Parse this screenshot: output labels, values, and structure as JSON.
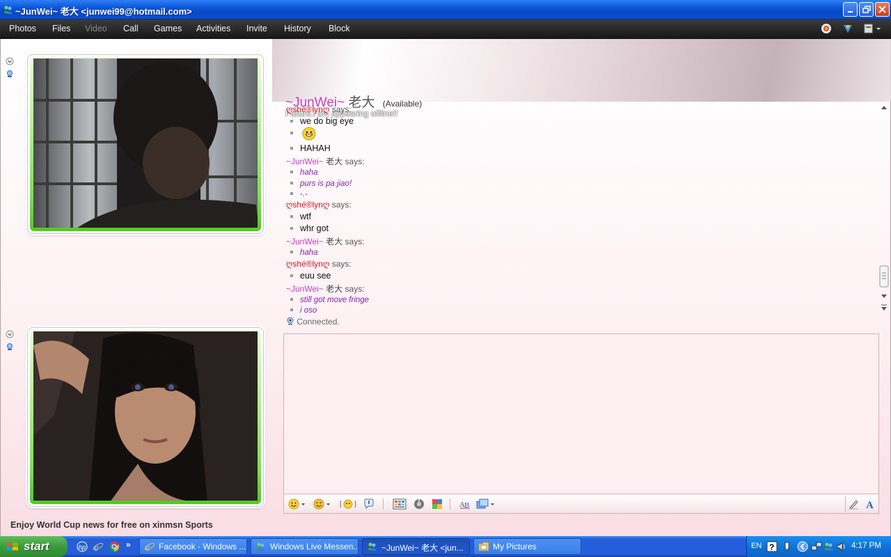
{
  "window": {
    "title": "~JunWei~ 老大 <junwei99@hotmail.com>",
    "controls": [
      "minimize",
      "restore",
      "close"
    ]
  },
  "menu": {
    "items": [
      {
        "label": "Photos",
        "enabled": true
      },
      {
        "label": "Files",
        "enabled": true
      },
      {
        "label": "Video",
        "enabled": false
      },
      {
        "label": "Call",
        "enabled": true
      },
      {
        "label": "Games",
        "enabled": true
      },
      {
        "label": "Activities",
        "enabled": true
      },
      {
        "label": "Invite",
        "enabled": true
      },
      {
        "label": "History",
        "enabled": true
      },
      {
        "label": "Block",
        "enabled": true
      }
    ],
    "right_icons": [
      "activity-icon",
      "shield-icon",
      "show-menu-icon"
    ]
  },
  "contact": {
    "name": "~JunWei~",
    "name_cjk": "老大",
    "status": "(Available)",
    "personal_message": "Failure.i am appearing offline!!"
  },
  "conversation": [
    {
      "type": "sender",
      "who": "her",
      "name": "ღshé®lynღ",
      "cjk": "",
      "says": "says:"
    },
    {
      "type": "msg",
      "who": "her",
      "text": "we do big eye"
    },
    {
      "type": "emoticon",
      "who": "her",
      "icon": "smiley-emoticon"
    },
    {
      "type": "msg",
      "who": "her",
      "text": "HAHAH"
    },
    {
      "type": "sender",
      "who": "him",
      "name": "~JunWei~",
      "cjk": "老大",
      "says": "says:"
    },
    {
      "type": "msg",
      "who": "him",
      "text": "haha"
    },
    {
      "type": "msg",
      "who": "him",
      "text": "purs is pa jiao!"
    },
    {
      "type": "msg",
      "who": "him",
      "text": "-.-"
    },
    {
      "type": "sender",
      "who": "her",
      "name": "ღshé®lynღ",
      "cjk": "",
      "says": "says:"
    },
    {
      "type": "msg",
      "who": "her",
      "text": "wtf"
    },
    {
      "type": "msg",
      "who": "her",
      "text": "whr got"
    },
    {
      "type": "sender",
      "who": "him",
      "name": "~JunWei~",
      "cjk": "老大",
      "says": "says:"
    },
    {
      "type": "msg",
      "who": "him",
      "text": "haha"
    },
    {
      "type": "sender",
      "who": "her",
      "name": "ღshé®lynღ",
      "cjk": "",
      "says": "says:"
    },
    {
      "type": "msg",
      "who": "her",
      "text": "euu see"
    },
    {
      "type": "sender",
      "who": "him",
      "name": "~JunWei~",
      "cjk": "老大",
      "says": "says:"
    },
    {
      "type": "msg",
      "who": "him",
      "text": "still got move fringe"
    },
    {
      "type": "msg",
      "who": "him",
      "text": "i oso"
    }
  ],
  "webcam_status": "Connected.",
  "input": {
    "value": "",
    "toolbar_icons": [
      "emoticon-icon",
      "wink-icon",
      "nudge-icon",
      "voice-clip-icon",
      "background-icon",
      "games-icon",
      "winks-icon",
      "spellcheck-icon",
      "send-files-icon",
      "handwriting-icon",
      "font-icon"
    ]
  },
  "ad_text": "Enjoy World Cup news for free on xinmsn Sports",
  "taskbar": {
    "start_label": "start",
    "quick_launch": [
      "hp-icon",
      "ie-icon",
      "chrome-icon"
    ],
    "buttons": [
      {
        "label": "Facebook - Windows ...",
        "icon": "ie-icon",
        "active": false
      },
      {
        "label": "Windows Live Messen...",
        "icon": "messenger-icon",
        "active": false
      },
      {
        "label": "~JunWei~ 老大 <jun...",
        "icon": "messenger-icon",
        "active": true
      },
      {
        "label": "My Pictures",
        "icon": "folder-icon",
        "active": false
      }
    ],
    "tray": {
      "language": "EN",
      "clock": "4:17 PM"
    }
  },
  "colors": {
    "her_name": "#d4141c",
    "him_name": "#c43fc0",
    "him_text": "#8a1fb3",
    "cam_glow": "#5fd02a",
    "title_bar": "#0b57d8",
    "taskbar": "#245edb"
  }
}
